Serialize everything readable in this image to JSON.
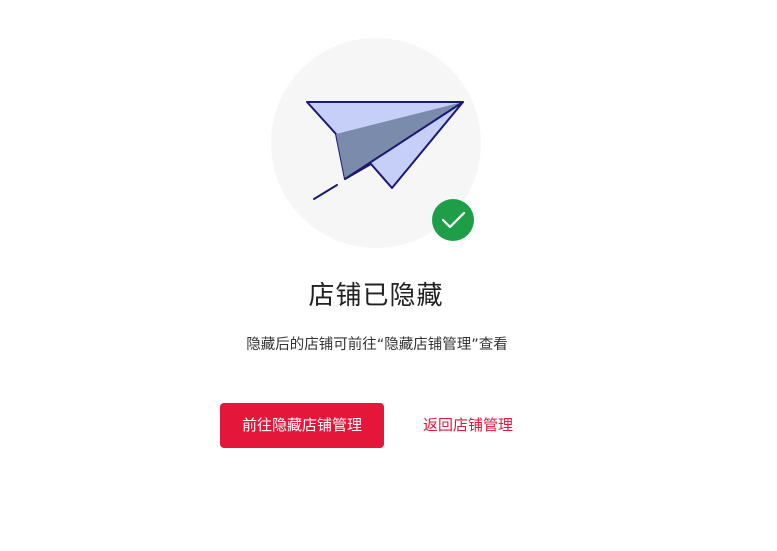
{
  "result": {
    "title": "店铺已隐藏",
    "description": "隐藏后的店铺可前往“隐藏店铺管理”查看"
  },
  "actions": {
    "primary_label": "前往隐藏店铺管理",
    "secondary_label": "返回店铺管理"
  },
  "colors": {
    "accent": "#e4163a",
    "success": "#1f9e48",
    "circle_bg": "#f6f6f6",
    "plane_fill": "#c5cff8",
    "plane_shadow": "#7a8bab",
    "plane_stroke": "#1b1a73"
  },
  "icons": {
    "illustration": "paper-plane-icon",
    "status": "success-check-icon"
  }
}
